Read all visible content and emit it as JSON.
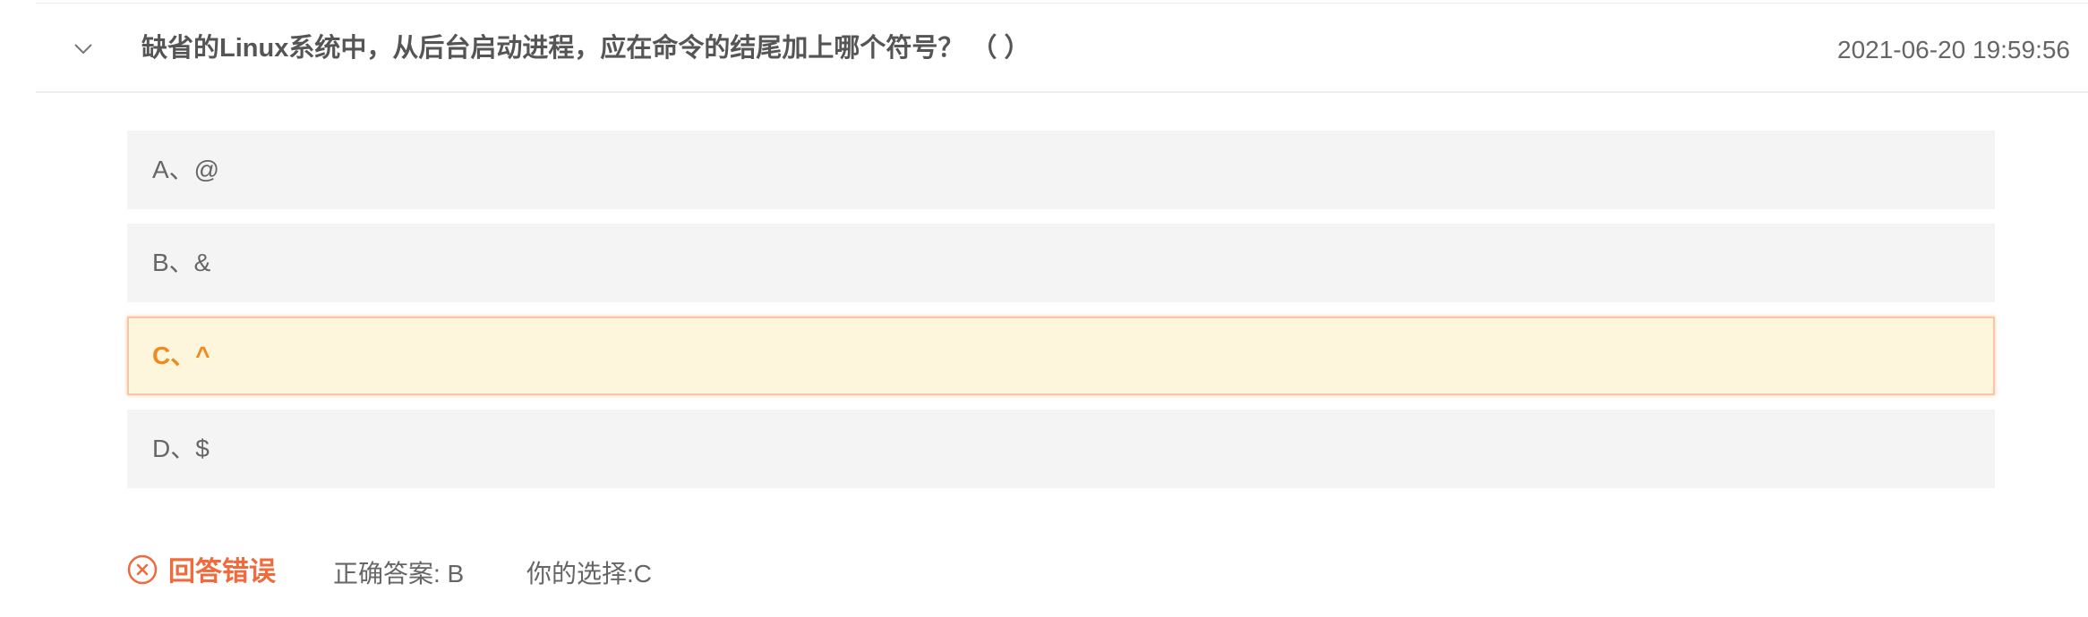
{
  "question": {
    "text": "缺省的Linux系统中，从后台启动进程，应在命令的结尾加上哪个符号？  （ ）",
    "timestamp": "2021-06-20 19:59:56",
    "expand_icon": "chevron-down-icon"
  },
  "options": [
    {
      "label": "A、@",
      "selected": false
    },
    {
      "label": "B、&",
      "selected": false
    },
    {
      "label": "C、^",
      "selected": true
    },
    {
      "label": "D、$",
      "selected": false
    }
  ],
  "result": {
    "status_icon": "close-circle-icon",
    "status": "回答错误",
    "correct_answer": "正确答案: B",
    "your_choice": "你的选择:C",
    "colors": {
      "error": "#f06a3c",
      "selected_text": "#f08a1c",
      "selected_bg": "#fdf6dc",
      "option_bg": "#f4f4f4"
    }
  }
}
